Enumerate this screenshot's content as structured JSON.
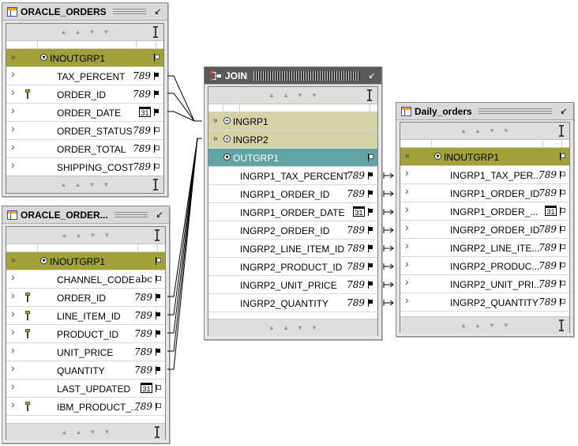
{
  "operators": {
    "oracle_orders": {
      "title": "ORACLE_ORDERS",
      "group": "INOUTGRP1",
      "rows": [
        {
          "name": "TAX_PERCENT",
          "type": "number",
          "key": false
        },
        {
          "name": "ORDER_ID",
          "type": "number",
          "key": true
        },
        {
          "name": "ORDER_DATE",
          "type": "date",
          "key": false
        },
        {
          "name": "ORDER_STATUS",
          "type": "number",
          "key": false
        },
        {
          "name": "ORDER_TOTAL",
          "type": "number",
          "key": false
        },
        {
          "name": "SHIPPING_COST",
          "type": "number",
          "key": false
        }
      ]
    },
    "oracle_order_items": {
      "title": "ORACLE_ORDER...",
      "group": "INOUTGRP1",
      "rows": [
        {
          "name": "CHANNEL_CODE",
          "type": "varchar",
          "key": false
        },
        {
          "name": "ORDER_ID",
          "type": "number",
          "key": true
        },
        {
          "name": "LINE_ITEM_ID",
          "type": "number",
          "key": true
        },
        {
          "name": "PRODUCT_ID",
          "type": "number",
          "key": true
        },
        {
          "name": "UNIT_PRICE",
          "type": "number",
          "key": false
        },
        {
          "name": "QUANTITY",
          "type": "number",
          "key": false
        },
        {
          "name": "LAST_UPDATED",
          "type": "date",
          "key": false
        },
        {
          "name": "IBM_PRODUCT_...",
          "type": "number",
          "key": true
        }
      ]
    },
    "join": {
      "title": "JOIN",
      "groups": [
        "INGRP1",
        "INGRP2"
      ],
      "out_group": "OUTGRP1",
      "rows": [
        {
          "name": "INGRP1_TAX_PERCENT",
          "type": "number"
        },
        {
          "name": "INGRP1_ORDER_ID",
          "type": "number"
        },
        {
          "name": "INGRP1_ORDER_DATE",
          "type": "date"
        },
        {
          "name": "INGRP2_ORDER_ID",
          "type": "number"
        },
        {
          "name": "INGRP2_LINE_ITEM_ID",
          "type": "number"
        },
        {
          "name": "INGRP2_PRODUCT_ID",
          "type": "number"
        },
        {
          "name": "INGRP2_UNIT_PRICE",
          "type": "number"
        },
        {
          "name": "INGRP2_QUANTITY",
          "type": "number"
        }
      ]
    },
    "daily_orders": {
      "title": "Daily_orders",
      "group": "INOUTGRP1",
      "rows": [
        {
          "name": "INGRP1_TAX_PER...",
          "type": "number"
        },
        {
          "name": "INGRP1_ORDER_ID",
          "type": "number"
        },
        {
          "name": "INGRP1_ORDER_...",
          "type": "date"
        },
        {
          "name": "INGRP2_ORDER_ID",
          "type": "number"
        },
        {
          "name": "INGRP2_LINE_ITE...",
          "type": "number"
        },
        {
          "name": "INGRP2_PRODUC...",
          "type": "number"
        },
        {
          "name": "INGRP2_UNIT_PRI...",
          "type": "number"
        },
        {
          "name": "INGRP2_QUANTITY",
          "type": "number"
        }
      ]
    }
  },
  "type_glyphs": {
    "number": "789",
    "date": "31",
    "varchar": "abc"
  },
  "colors": {
    "group_olive": "#a1a13a",
    "group_light": "#d3d3a6",
    "group_teal": "#62a3a3"
  }
}
